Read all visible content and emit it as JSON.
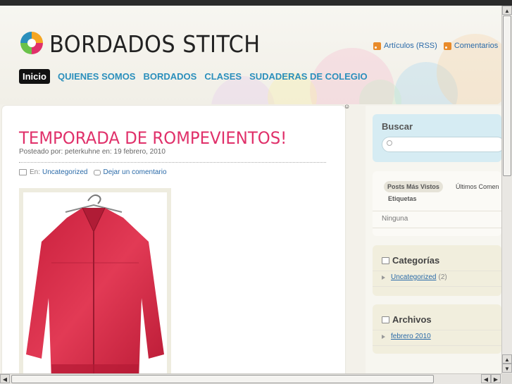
{
  "site": {
    "title": "BORDADOS STITCH"
  },
  "feeds": {
    "articles": "Artículos (RSS)",
    "comments": "Comentarios"
  },
  "nav": {
    "items": [
      {
        "label": "Inicio"
      },
      {
        "label": "QUIENES SOMOS"
      },
      {
        "label": "BORDADOS"
      },
      {
        "label": "CLASES"
      },
      {
        "label": "SUDADERAS DE COLEGIO"
      }
    ]
  },
  "post": {
    "title": "TEMPORADA DE ROMPEVIENTOS!",
    "meta": "Posteado por: peterkuhne en: 19 febrero, 2010",
    "in_label": "En:",
    "category": "Uncategorized",
    "comment_link": "Dejar un comentario"
  },
  "sidebar": {
    "search": {
      "title": "Buscar",
      "value": ""
    },
    "tabs": {
      "items": [
        "Posts Más Vistos",
        "Últimos Comen",
        "Etiquetas"
      ],
      "empty_text": "Ninguna"
    },
    "categories": {
      "title": "Categorías",
      "items": [
        {
          "label": "Uncategorized",
          "count": "(2)"
        }
      ]
    },
    "archives": {
      "title": "Archivos",
      "items": [
        {
          "label": "febrero 2010"
        }
      ]
    }
  },
  "colors": {
    "accent_pink": "#e0306a",
    "nav_blue": "#2b8fbc",
    "link_blue": "#2a6aa8",
    "jacket_red": "#d42a45"
  }
}
